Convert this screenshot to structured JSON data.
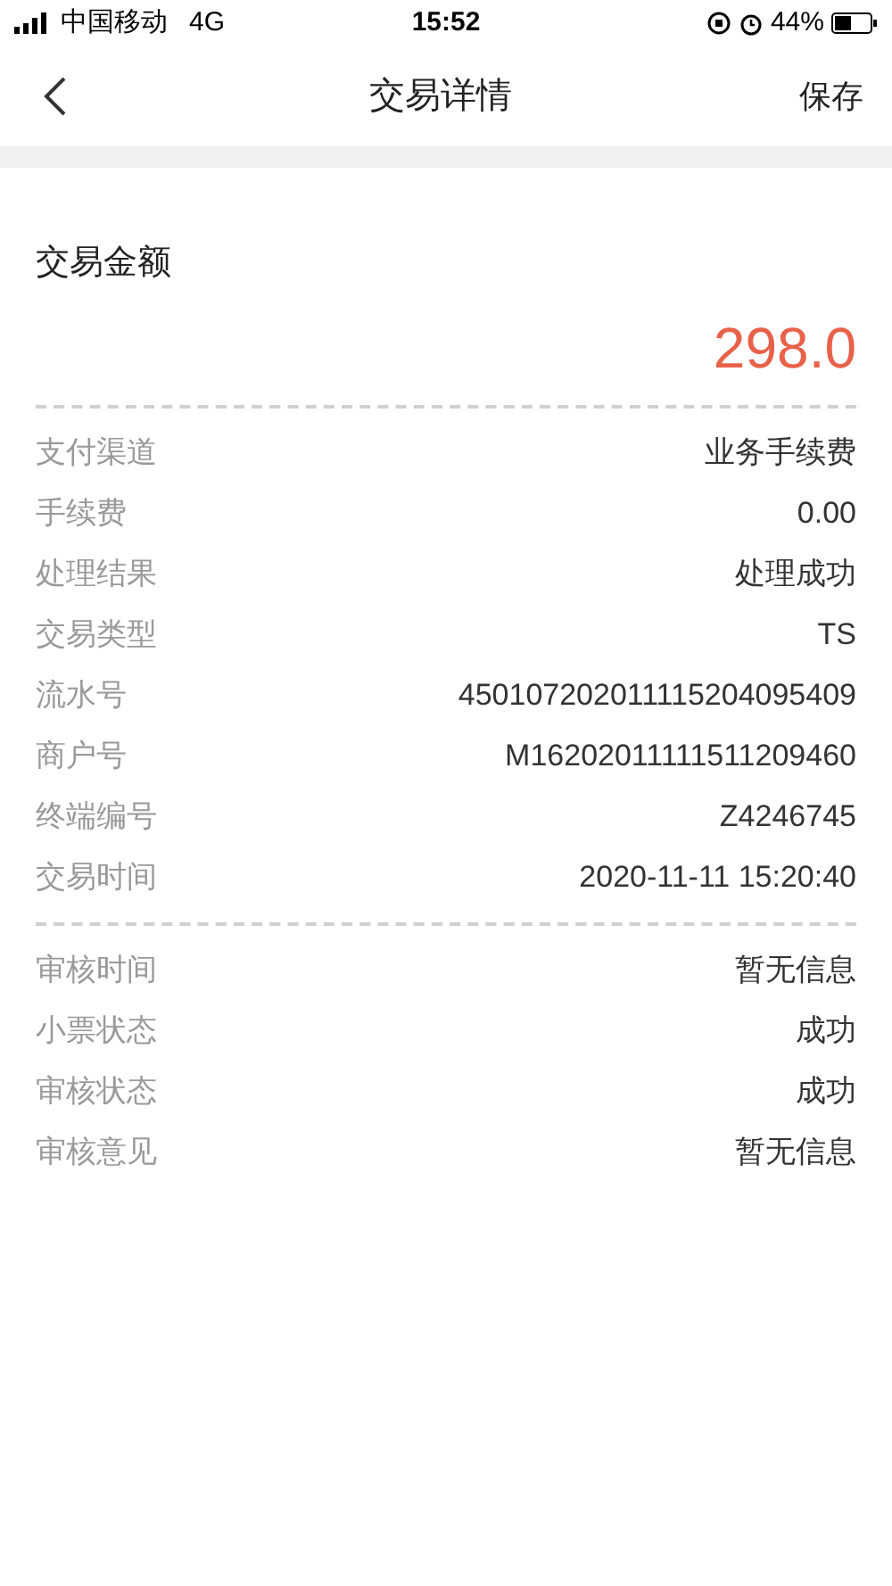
{
  "status_bar": {
    "carrier": "中国移动",
    "network": "4G",
    "time": "15:52",
    "battery": "44%"
  },
  "nav": {
    "title": "交易详情",
    "action": "保存"
  },
  "amount": {
    "label": "交易金额",
    "value": "298.0"
  },
  "sections": [
    {
      "rows": [
        {
          "label": "支付渠道",
          "value": "业务手续费"
        },
        {
          "label": "手续费",
          "value": "0.00"
        },
        {
          "label": "处理结果",
          "value": "处理成功"
        },
        {
          "label": "交易类型",
          "value": "TS"
        },
        {
          "label": "流水号",
          "value": "450107202011115204095409"
        },
        {
          "label": "商户号",
          "value": "M16202011111511209460"
        },
        {
          "label": "终端编号",
          "value": "Z4246745"
        },
        {
          "label": "交易时间",
          "value": "2020-11-11 15:20:40"
        }
      ]
    },
    {
      "rows": [
        {
          "label": "审核时间",
          "value": "暂无信息"
        },
        {
          "label": "小票状态",
          "value": "成功"
        },
        {
          "label": "审核状态",
          "value": "成功"
        },
        {
          "label": "审核意见",
          "value": "暂无信息"
        }
      ]
    }
  ]
}
